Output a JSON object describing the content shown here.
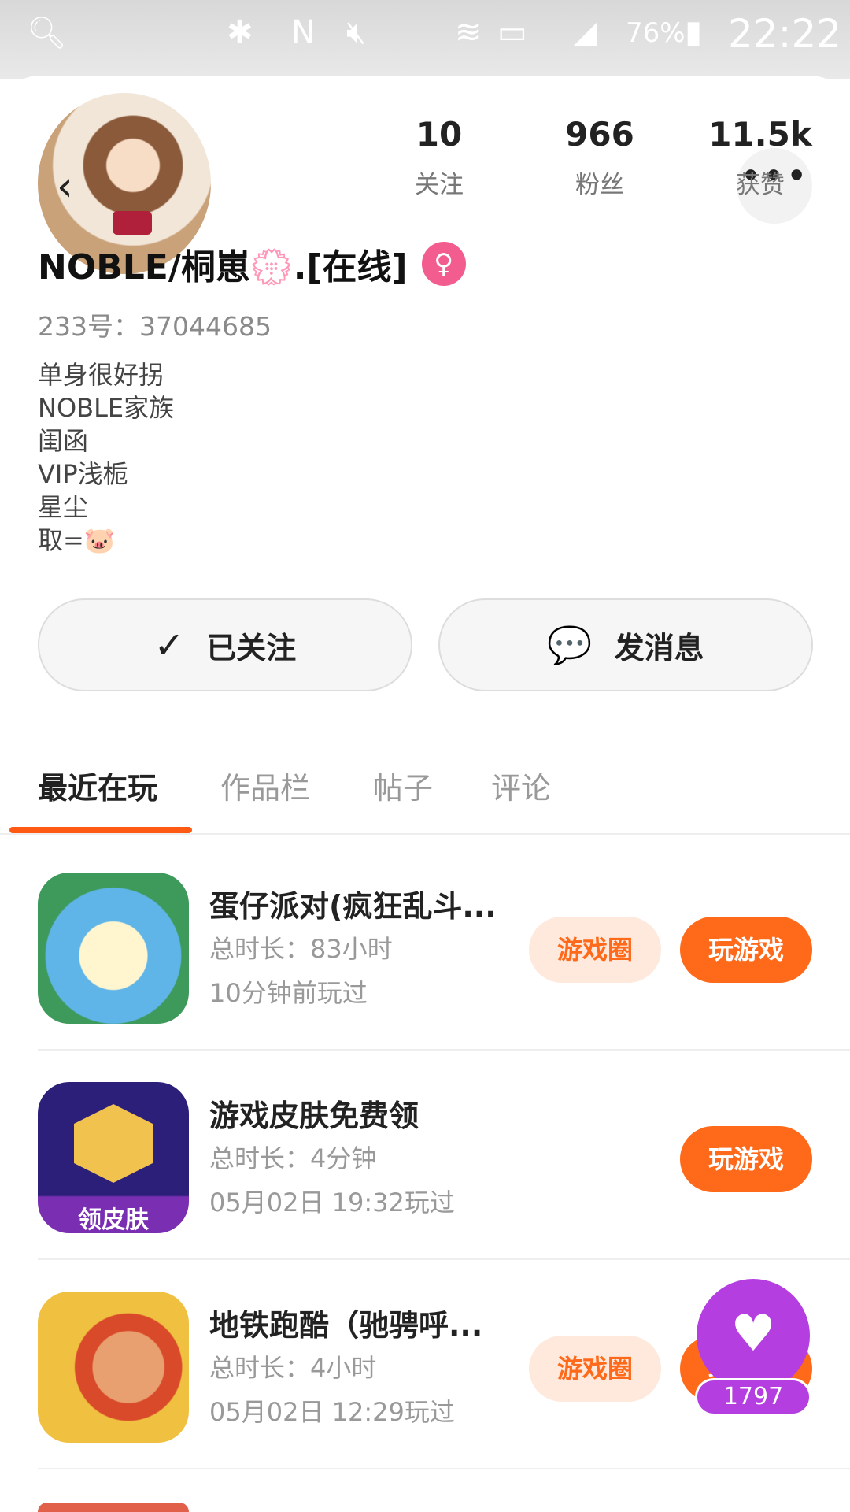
{
  "status_bar": {
    "battery_percent": "76%",
    "time": "22:22",
    "icons": [
      "search-icon",
      "bluetooth-icon",
      "nfc-icon",
      "mute-icon",
      "wifi-icon",
      "sim-icon",
      "signal-icon",
      "battery-icon"
    ]
  },
  "header": {
    "back_icon": "‹",
    "more_icon": "•••",
    "stats": [
      {
        "value": "10",
        "label": "关注"
      },
      {
        "value": "966",
        "label": "粉丝"
      },
      {
        "value": "11.5k",
        "label": "获赞"
      }
    ]
  },
  "profile": {
    "username": "NOBLE/桐崽💮.[在线]",
    "gender_icon": "♀",
    "user_id": "233号：37044685",
    "bio": [
      "单身很好拐",
      "NOBLE家族",
      "闺函",
      "VIP浅栀",
      "星尘",
      "取=🐷"
    ]
  },
  "actions": {
    "follow_icon": "✓",
    "follow_label": "已关注",
    "message_icon": "💬",
    "message_label": "发消息"
  },
  "tabs": [
    "最近在玩",
    "作品栏",
    "帖子",
    "评论"
  ],
  "games": [
    {
      "title": "蛋仔派对(疯狂乱斗...",
      "duration": "总时长：83小时",
      "last_played": "10分钟前玩过",
      "circle_label": "游戏圈",
      "play_label": "玩游戏"
    },
    {
      "title": "游戏皮肤免费领",
      "duration": "总时长：4分钟",
      "last_played": "05月02日 19:32玩过",
      "icon_label": "领皮肤",
      "play_label": "玩游戏"
    },
    {
      "title": "地铁跑酷（驰骋呼...",
      "duration": "总时长：4小时",
      "last_played": "05月02日 12:29玩过",
      "circle_label": "游戏圈",
      "play_label": "玩游戏"
    }
  ],
  "like_float": {
    "icon": "♥",
    "count": "1797"
  },
  "colors": {
    "accent": "#ff6a1a",
    "tab_indicator": "#ff5a14",
    "gender": "#f25c8e",
    "like": "#b43ee0"
  }
}
